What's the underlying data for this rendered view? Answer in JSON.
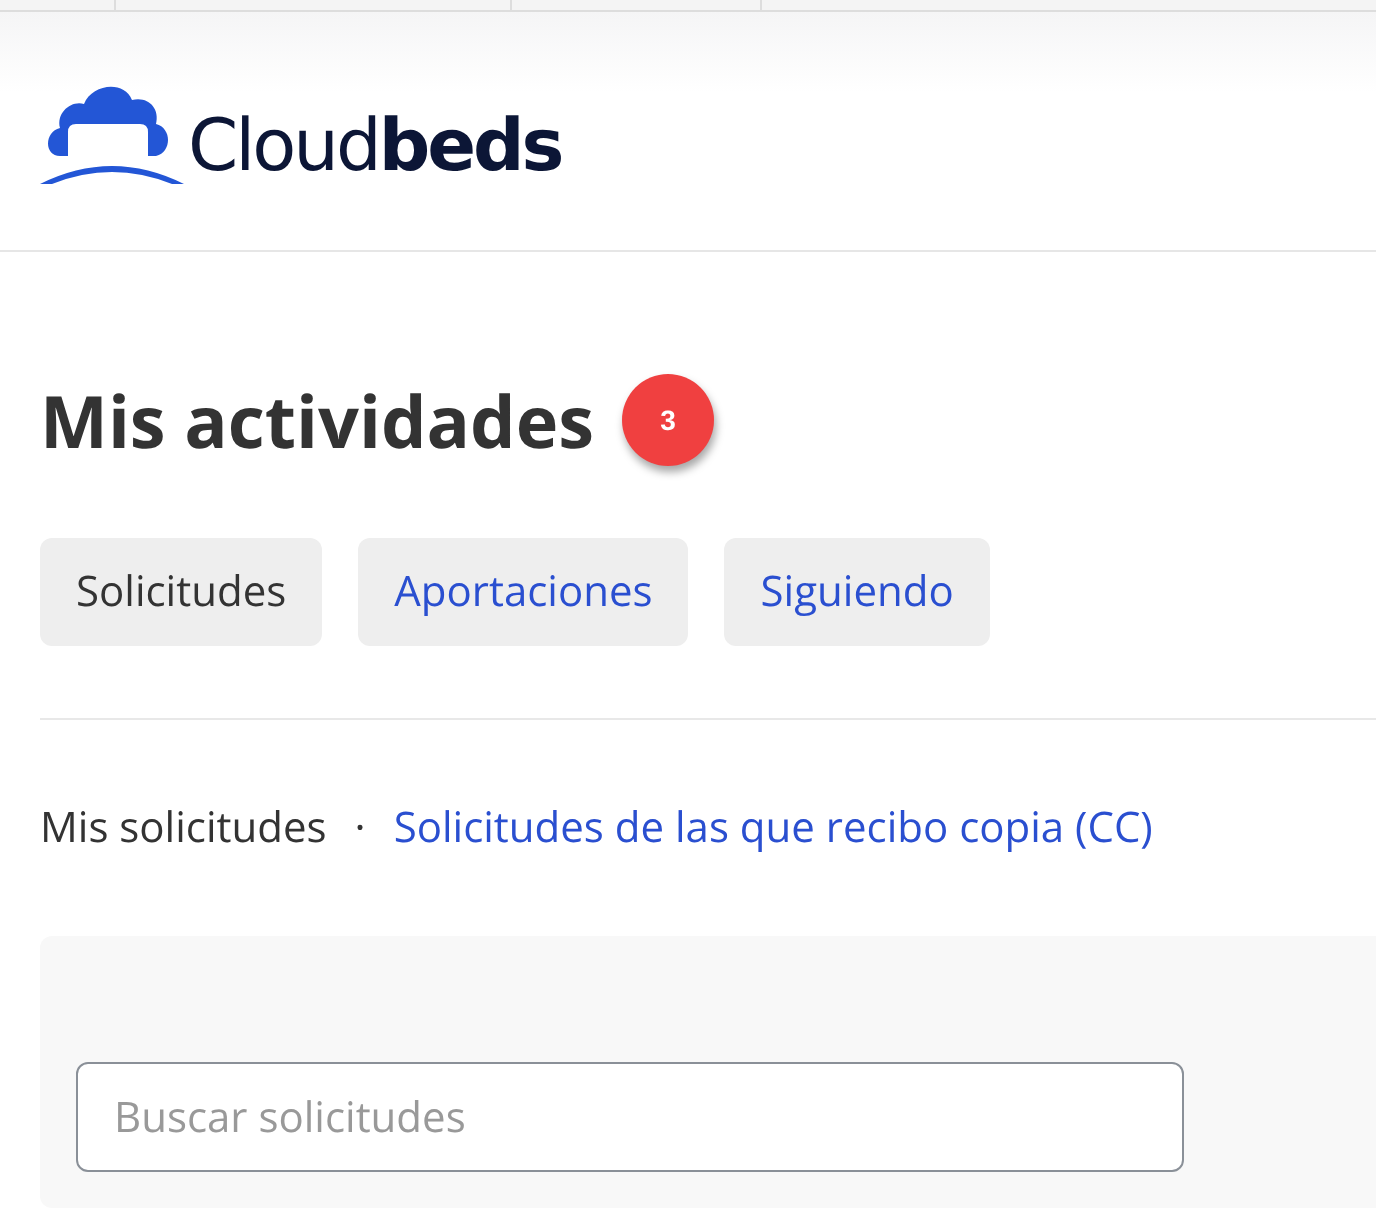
{
  "brand": {
    "name": "Cloud**beds**"
  },
  "heading": {
    "title": "Mis actividades",
    "badge": "3"
  },
  "tabs": [
    {
      "label": "Solicitudes",
      "selected": true
    },
    {
      "label": "Aportaciones",
      "selected": false
    },
    {
      "label": "Siguiendo",
      "selected": false
    }
  ],
  "subnav": [
    {
      "label": "Mis solicitudes",
      "selected": true
    },
    {
      "label": "Solicitudes de las que recibo copia (CC)",
      "selected": false
    }
  ],
  "subnav_separator": "·",
  "search": {
    "placeholder": "Buscar solicitudes"
  }
}
